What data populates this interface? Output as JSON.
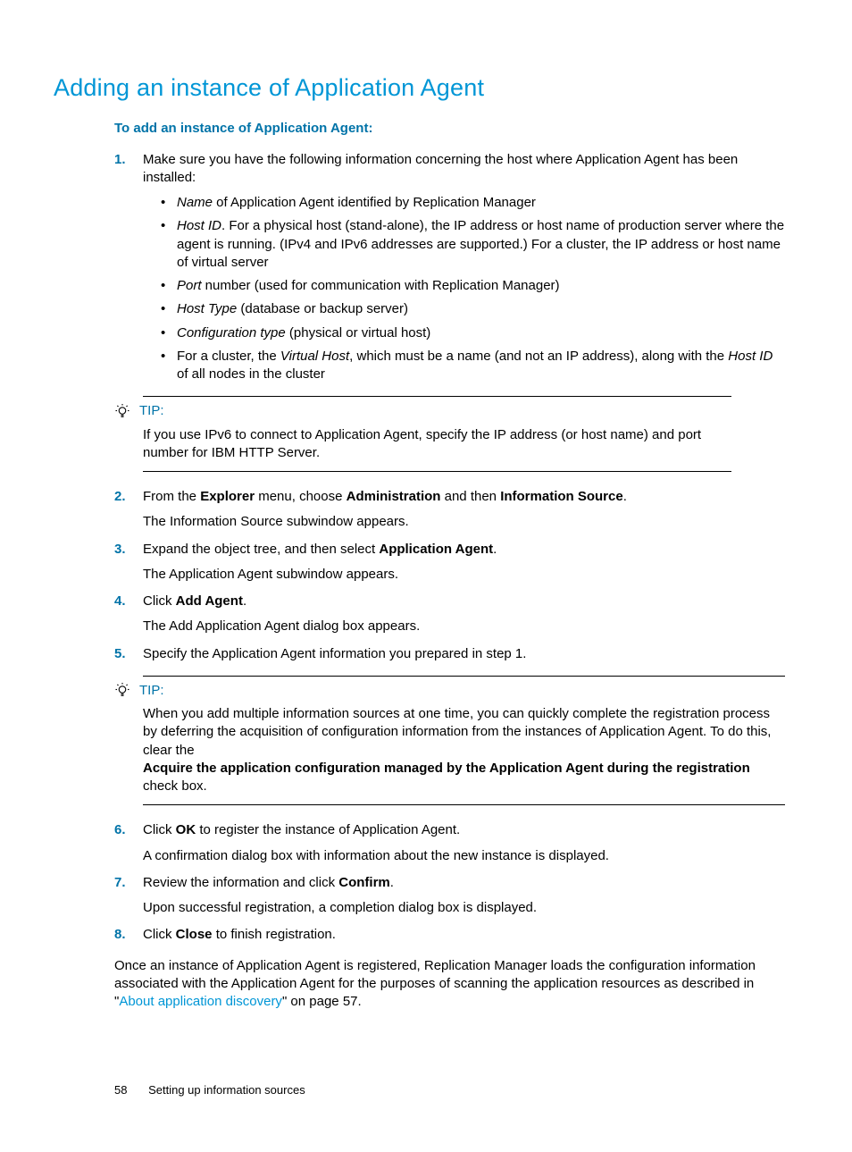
{
  "heading": "Adding an instance of Application Agent",
  "intro": "To add an instance of Application Agent:",
  "steps": {
    "s1": {
      "n": "1.",
      "lead": "Make sure you have the following information concerning the host where Application Agent has been installed:",
      "b1_em": "Name",
      "b1_rest": " of Application Agent identified by Replication Manager",
      "b2_em": "Host ID",
      "b2_rest": ". For a physical host (stand-alone), the IP address or host name of production server where the agent is running. (IPv4 and IPv6 addresses are supported.) For a cluster, the IP address or host name of virtual server",
      "b3_em": "Port",
      "b3_rest": " number (used for communication with Replication Manager)",
      "b4_em": "Host Type",
      "b4_rest": " (database or backup server)",
      "b5_em": "Configuration type",
      "b5_rest": " (physical or virtual host)",
      "b6_pre": "For a cluster, the ",
      "b6_em1": "Virtual Host",
      "b6_mid": ", which must be a name (and not an IP address), along with the ",
      "b6_em2": "Host ID",
      "b6_rest": " of all nodes in the cluster"
    },
    "tip1": {
      "label": "TIP:",
      "body": "If you use IPv6 to connect to Application Agent, specify the IP address (or host name) and port number for IBM HTTP Server."
    },
    "s2": {
      "n": "2.",
      "pre": "From the ",
      "b1": "Explorer",
      "mid1": " menu, choose ",
      "b2": "Administration",
      "mid2": " and then ",
      "b3": "Information Source",
      "post": ".",
      "result": "The Information Source subwindow appears."
    },
    "s3": {
      "n": "3.",
      "pre": "Expand the object tree, and then select ",
      "b1": "Application Agent",
      "post": ".",
      "result": "The Application Agent subwindow appears."
    },
    "s4": {
      "n": "4.",
      "pre": "Click ",
      "b1": "Add Agent",
      "post": ".",
      "result": "The Add Application Agent dialog box appears."
    },
    "s5": {
      "n": "5.",
      "text": "Specify the Application Agent information you prepared in step 1."
    },
    "tip2": {
      "label": "TIP:",
      "p1": "When you add multiple information sources at one time, you can quickly complete the registration process by deferring the acquisition of configuration information from the instances of Application Agent. To do this, clear the",
      "bold": "Acquire the application configuration managed by the Application Agent during the registration",
      "p2": "check box."
    },
    "s6": {
      "n": "6.",
      "pre": "Click ",
      "b1": "OK",
      "post": " to register the instance of Application Agent.",
      "result": "A confirmation dialog box with information about the new instance is displayed."
    },
    "s7": {
      "n": "7.",
      "pre": "Review the information and click ",
      "b1": "Confirm",
      "post": ".",
      "result": "Upon successful registration, a completion dialog box is displayed."
    },
    "s8": {
      "n": "8.",
      "pre": "Click ",
      "b1": "Close",
      "post": " to finish registration."
    }
  },
  "closing": {
    "pre": "Once an instance of Application Agent is registered, Replication Manager loads the configuration information associated with the Application Agent for the purposes of scanning the application resources as described in \"",
    "link": "About application discovery",
    "post": "\" on page 57."
  },
  "footer": {
    "page": "58",
    "section": "Setting up information sources"
  }
}
